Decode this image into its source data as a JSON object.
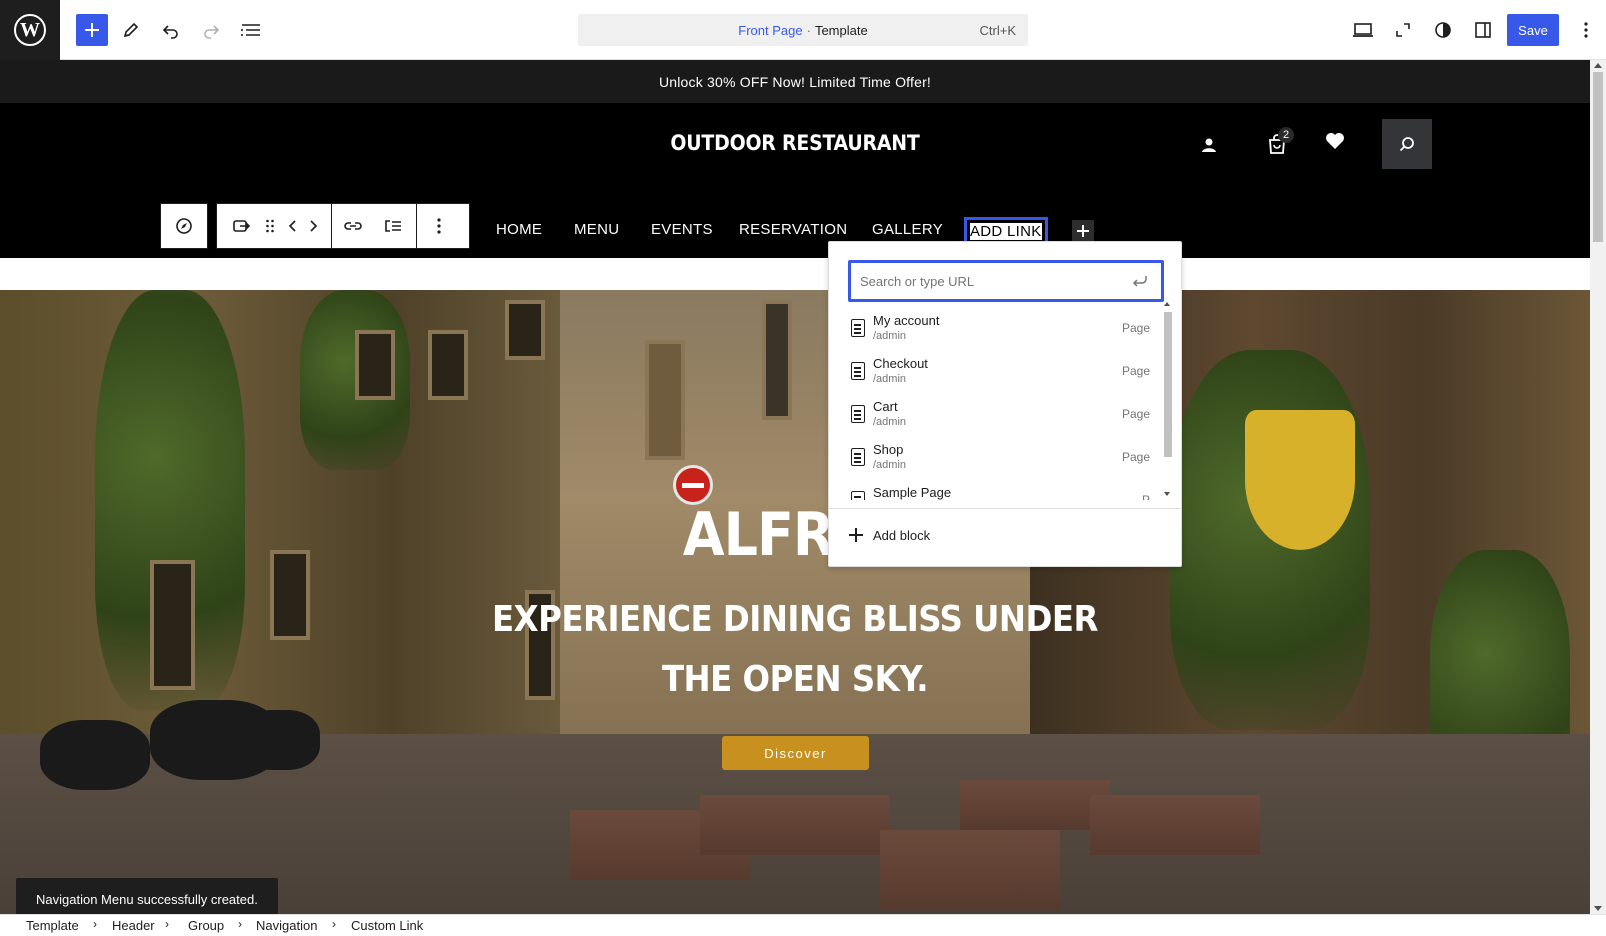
{
  "toolbar": {
    "command_context": "Front Page",
    "command_separator": "·",
    "command_type": "Template",
    "command_shortcut": "Ctrl+K",
    "save_label": "Save"
  },
  "site": {
    "promo_text": "Unlock 30% OFF Now! Limited Time Offer!",
    "title": "OUTDOOR RESTAURANT",
    "cart_count": "2",
    "nav": {
      "items": [
        "HOME",
        "MENU",
        "EVENTS",
        "RESERVATION",
        "GALLERY"
      ],
      "add_link": "ADD LINK"
    },
    "hero": {
      "title": "ALFRES",
      "subtitle_line1": "EXPERIENCE DINING BLISS UNDER",
      "subtitle_line2": "THE OPEN SKY.",
      "button": "Discover"
    }
  },
  "link_popover": {
    "placeholder": "Search or type URL",
    "results": [
      {
        "title": "My account",
        "url": "/admin",
        "type": "Page"
      },
      {
        "title": "Checkout",
        "url": "/admin",
        "type": "Page"
      },
      {
        "title": "Cart",
        "url": "/admin",
        "type": "Page"
      },
      {
        "title": "Shop",
        "url": "/admin",
        "type": "Page"
      },
      {
        "title": "Sample Page",
        "url": "",
        "type": "P"
      }
    ],
    "add_block": "Add block"
  },
  "snackbar": "Navigation Menu successfully created.",
  "breadcrumbs": [
    "Template",
    "Header",
    "Group",
    "Navigation",
    "Custom Link"
  ],
  "colors": {
    "accent": "#3858e9",
    "hero_button": "#c8911f",
    "header_bg": "#000000"
  }
}
